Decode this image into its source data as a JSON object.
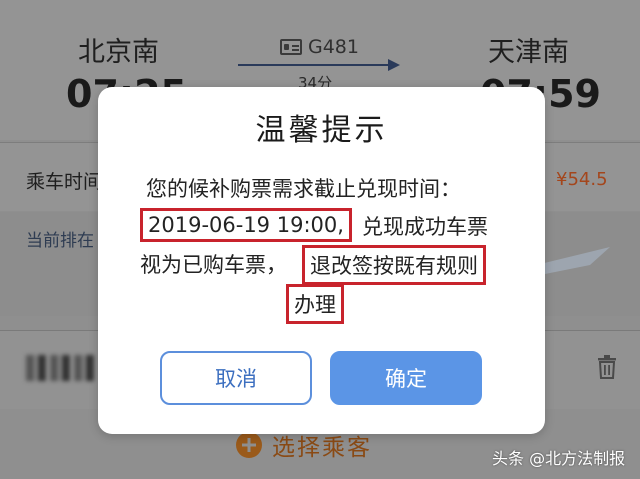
{
  "trip": {
    "from_station": "北京南",
    "to_station": "天津南",
    "train_no": "G481",
    "departure_time": "07:25",
    "arrival_time": "07:59",
    "duration": "34分",
    "ride_time_label": "乘车时间",
    "price": "¥54.5",
    "queue_label": "当前排在"
  },
  "passenger": {
    "add_label": "选择乘客"
  },
  "dialog": {
    "title": "温馨提示",
    "line1": "您的候补购票需求截止兑现时间：",
    "line2_deadline": "2019-06-19 19:00,",
    "line2_rest": "兑现成功车票",
    "line3_start": "视为已购车票，",
    "line3_rule": "退改签按既有规则",
    "line4": "办理",
    "cancel_label": "取消",
    "confirm_label": "确定"
  },
  "source_watermark": "头条 @北方法制报",
  "colors": {
    "highlight_border": "#c8232c",
    "primary_button": "#5b95e6",
    "overlay_dim": "#8f8f8f"
  }
}
